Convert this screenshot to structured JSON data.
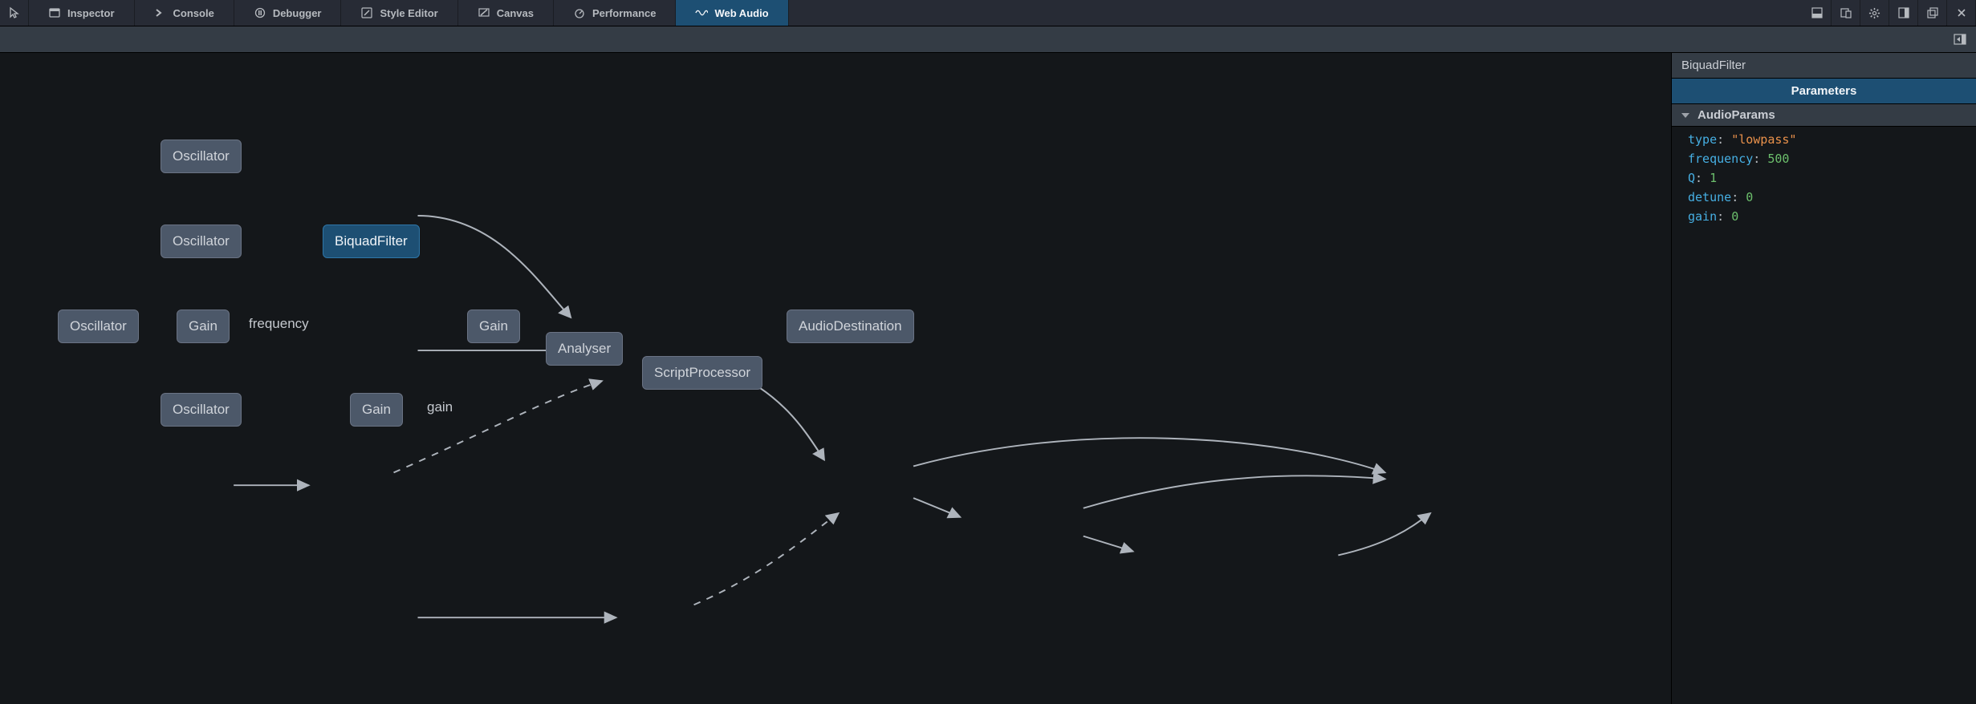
{
  "toolbar": {
    "tabs": [
      {
        "label": "Inspector"
      },
      {
        "label": "Console"
      },
      {
        "label": "Debugger"
      },
      {
        "label": "Style Editor"
      },
      {
        "label": "Canvas"
      },
      {
        "label": "Performance"
      },
      {
        "label": "Web Audio"
      }
    ],
    "active_tab": "Web Audio"
  },
  "graph": {
    "nodes": [
      {
        "id": "osc1",
        "label": "Oscillator"
      },
      {
        "id": "osc2",
        "label": "Oscillator"
      },
      {
        "id": "biquad",
        "label": "BiquadFilter",
        "selected": true
      },
      {
        "id": "osc3",
        "label": "Oscillator"
      },
      {
        "id": "gain1",
        "label": "Gain"
      },
      {
        "id": "osc4",
        "label": "Oscillator"
      },
      {
        "id": "gain2",
        "label": "Gain"
      },
      {
        "id": "gain3",
        "label": "Gain"
      },
      {
        "id": "analyser",
        "label": "Analyser"
      },
      {
        "id": "script",
        "label": "ScriptProcessor"
      },
      {
        "id": "dest",
        "label": "AudioDestination"
      }
    ],
    "edge_labels": {
      "freq": "frequency",
      "gain": "gain"
    }
  },
  "inspector": {
    "title": "BiquadFilter",
    "tab_label": "Parameters",
    "section_label": "AudioParams",
    "params": [
      {
        "key": "type",
        "value": "\"lowpass\"",
        "kind": "str"
      },
      {
        "key": "frequency",
        "value": "500",
        "kind": "num"
      },
      {
        "key": "Q",
        "value": "1",
        "kind": "num"
      },
      {
        "key": "detune",
        "value": "0",
        "kind": "num"
      },
      {
        "key": "gain",
        "value": "0",
        "kind": "num"
      }
    ]
  }
}
